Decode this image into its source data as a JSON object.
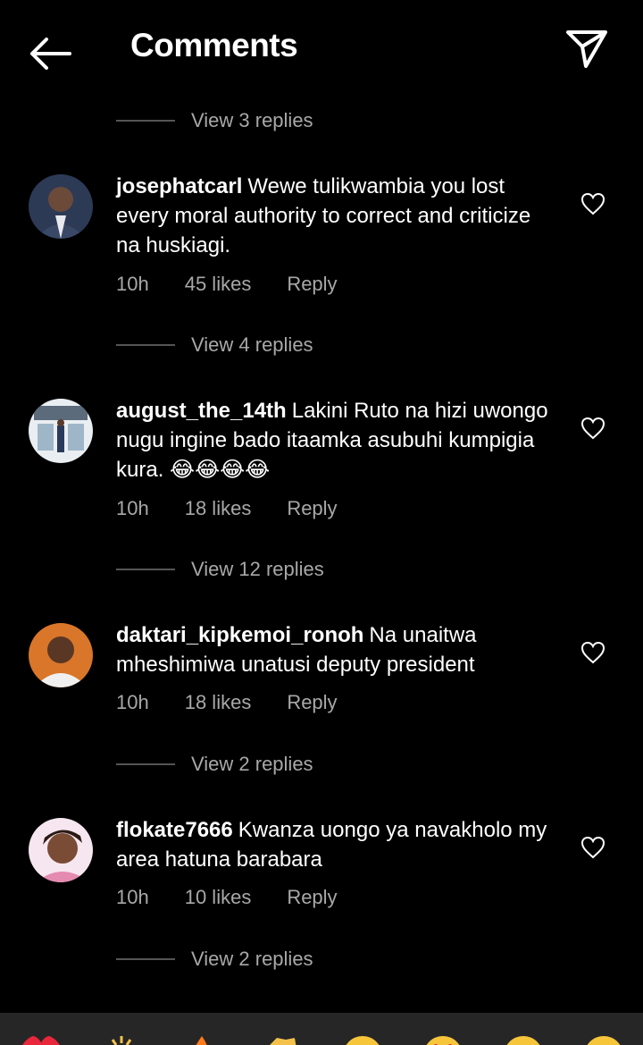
{
  "header": {
    "title": "Comments"
  },
  "view_replies": [
    "View 3 replies",
    "View 4 replies",
    "View 12 replies",
    "View 2 replies",
    "View 2 replies"
  ],
  "comments": [
    {
      "username": "josephatcarl",
      "text": "Wewe tulikwambia you lost every moral authority to correct and criticize na huskiagi.",
      "time": "10h",
      "likes": "45 likes",
      "reply": "Reply"
    },
    {
      "username": "august_the_14th",
      "text": "Lakini Ruto na hizi uwongo nugu ingine bado itaamka asubuhi kumpigia kura.",
      "emoji": "😂😂😂😂",
      "time": "10h",
      "likes": "18 likes",
      "reply": "Reply"
    },
    {
      "username": "daktari_kipkemoi_ronoh",
      "text": "Na unaitwa mheshimiwa unatusi deputy president",
      "time": "10h",
      "likes": "18 likes",
      "reply": "Reply"
    },
    {
      "username": "flokate7666",
      "text": "Kwanza uongo ya navakholo my area hatuna barabara",
      "time": "10h",
      "likes": "10 likes",
      "reply": "Reply"
    }
  ],
  "emoji_bar": [
    "heart",
    "raised-hands",
    "fire",
    "clap",
    "crying-face",
    "heart-eyes",
    "shocked-face",
    "laughing-face"
  ],
  "colors": {
    "background": "#000000",
    "secondary_text": "#a8a8a8",
    "emoji_bar": "#262626"
  }
}
